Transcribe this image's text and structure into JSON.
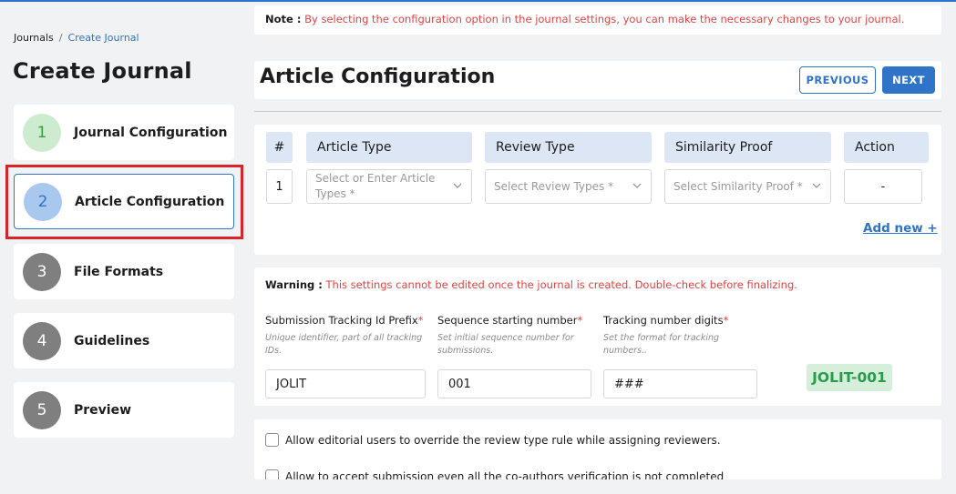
{
  "breadcrumb": {
    "root": "Journals",
    "separator": "/",
    "current": "Create Journal"
  },
  "page_title": "Create Journal",
  "steps": [
    {
      "number": "1",
      "label": "Journal Configuration",
      "state": "done"
    },
    {
      "number": "2",
      "label": "Article Configuration",
      "state": "active"
    },
    {
      "number": "3",
      "label": "File Formats",
      "state": "pending"
    },
    {
      "number": "4",
      "label": "Guidelines",
      "state": "pending"
    },
    {
      "number": "5",
      "label": "Preview",
      "state": "pending"
    }
  ],
  "note": {
    "prefix": "Note :",
    "text": "By selecting the configuration option in the journal settings, you can make the necessary changes to your journal."
  },
  "section": {
    "title": "Article Configuration",
    "previous_label": "PREVIOUS",
    "next_label": "NEXT"
  },
  "table": {
    "headers": {
      "index": "#",
      "article_type": "Article Type",
      "review_type": "Review Type",
      "similarity_proof": "Similarity Proof",
      "action": "Action"
    },
    "rows": [
      {
        "index": "1",
        "article_type_placeholder": "Select or Enter Article Types *",
        "review_type_placeholder": "Select Review Types *",
        "similarity_proof_placeholder": "Select Similarity Proof *",
        "action": "-"
      }
    ],
    "add_new_label": "Add new +"
  },
  "tracking": {
    "warning_prefix": "Warning :",
    "warning_text": "This settings cannot be edited once the journal is created. Double-check before finalizing.",
    "prefix_label": "Submission Tracking Id Prefix",
    "prefix_help": "Unique identifier, part of all tracking IDs.",
    "prefix_value": "JOLIT",
    "sequence_label": "Sequence starting number",
    "sequence_help": "Set initial sequence number for submissions.",
    "sequence_value": "001",
    "digits_label": "Tracking number digits",
    "digits_help": "Set the format for tracking numbers..",
    "digits_value": "###",
    "required_mark": "*",
    "preview_id": "JOLIT-001"
  },
  "options": {
    "override_review_label": "Allow editorial users to override the review type rule while assigning reviewers.",
    "accept_submission_label": "Allow to accept submission even all the co-authors verification is not completed"
  },
  "colors": {
    "accent": "#2f74c8",
    "warning": "#e04343",
    "success": "#2c9a4c",
    "highlight": "#d9232b"
  }
}
